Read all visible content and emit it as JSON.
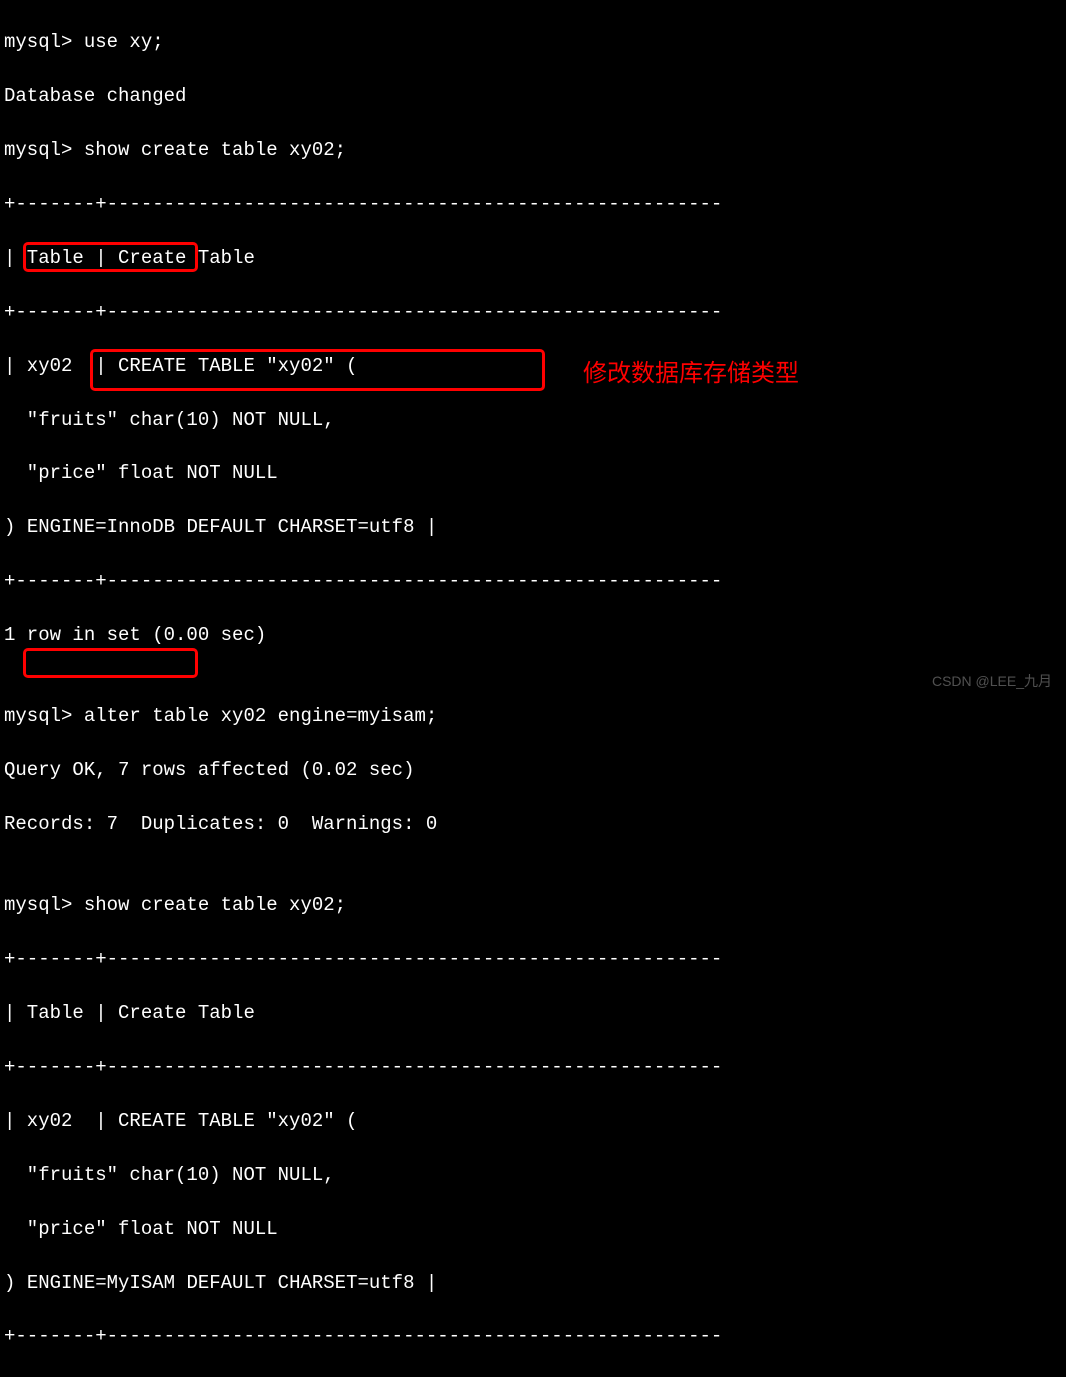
{
  "lines": {
    "l1": "mysql> use xy;",
    "l2": "Database changed",
    "l3": "mysql> show create table xy02;",
    "l4": "+-------+------------------------------------------------------",
    "l5": "| Table | Create Table",
    "l6": "+-------+------------------------------------------------------",
    "l7": "| xy02  | CREATE TABLE \"xy02\" (",
    "l8": "  \"fruits\" char(10) NOT NULL,",
    "l9": "  \"price\" float NOT NULL",
    "l10a": ") ",
    "l10b": "ENGINE=InnoDB",
    "l10c": " DEFAULT CHARSET=utf8 |",
    "l11": "+-------+------------------------------------------------------",
    "l12": "1 row in set (0.00 sec)",
    "l13": "",
    "l14a": "mysql> ",
    "l14b": "alter table xy02 engine=myisam;",
    "l15": "Query OK, 7 rows affected (0.02 sec)",
    "l16": "Records: 7  Duplicates: 0  Warnings: 0",
    "l17": "",
    "l18": "mysql> show create table xy02;",
    "l19": "+-------+------------------------------------------------------",
    "l20": "| Table | Create Table",
    "l21": "+-------+------------------------------------------------------",
    "l22": "| xy02  | CREATE TABLE \"xy02\" (",
    "l23": "  \"fruits\" char(10) NOT NULL,",
    "l24": "  \"price\" float NOT NULL",
    "l25a": ") ",
    "l25b": "ENGINE=MyISAM",
    "l25c": " DEFAULT CHARSET=utf8 |",
    "l26": "+-------+------------------------------------------------------"
  },
  "annotation": {
    "label": "修改数据库存储类型"
  },
  "watermark": "CSDN @LEE_九月"
}
